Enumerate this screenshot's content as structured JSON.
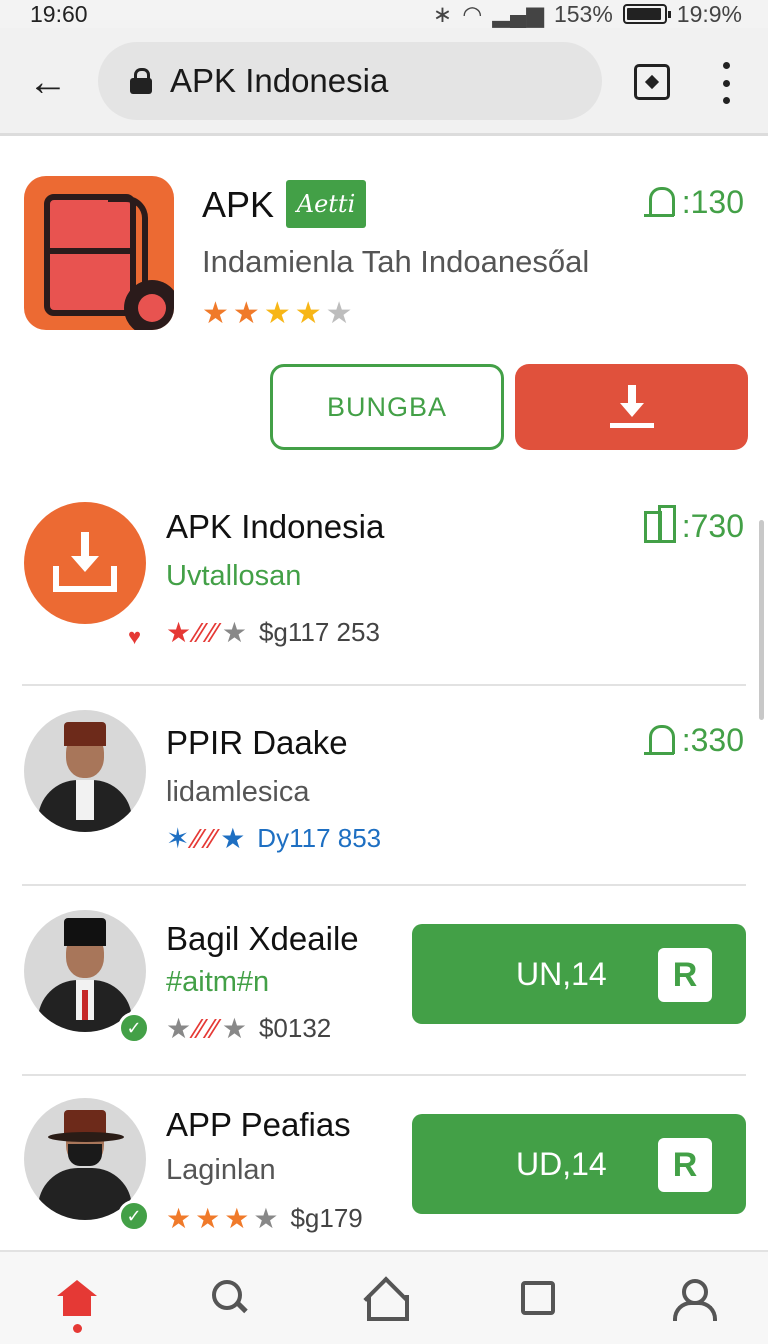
{
  "status": {
    "time": "19:60",
    "signal_text": "153%",
    "battery_text": "19:9%"
  },
  "browser": {
    "url": "APK Indonesia",
    "icons": [
      "back-arrow-icon",
      "lock-icon",
      "tab-switcher-icon",
      "more-vert-icon"
    ]
  },
  "featured": {
    "title": "APK",
    "badge": "Aetti",
    "stat": ":130",
    "subtitle": "Indamienla Tah Indoanesőal",
    "rating_stars": 4,
    "secondary_button": "BUNGBA",
    "primary_icon": "download-icon"
  },
  "list": [
    {
      "title": "APK Indonesia",
      "subtitle": "Uvtallosan",
      "stat": ":730",
      "rating_text": "$g117  253"
    },
    {
      "title": "PPIR Daake",
      "subtitle": "lidamlesica",
      "stat": ":330",
      "rating_text": "Dy117  853"
    },
    {
      "title": "Bagil Xdeaile",
      "subtitle": "#aitm#n",
      "rating_text": "$0132",
      "button_label": "UN,14",
      "button_glyph": "R"
    },
    {
      "title": "APP Peafias",
      "subtitle": "Laginlan",
      "rating_text": "$g179",
      "button_label": "UD,14",
      "button_glyph": "R"
    }
  ],
  "nav": [
    "home-icon",
    "search-icon",
    "house-outline-icon",
    "square-icon",
    "user-icon"
  ],
  "colors": {
    "accent_green": "#43a047",
    "accent_red": "#e0513c",
    "app_orange": "#ec6a33"
  }
}
